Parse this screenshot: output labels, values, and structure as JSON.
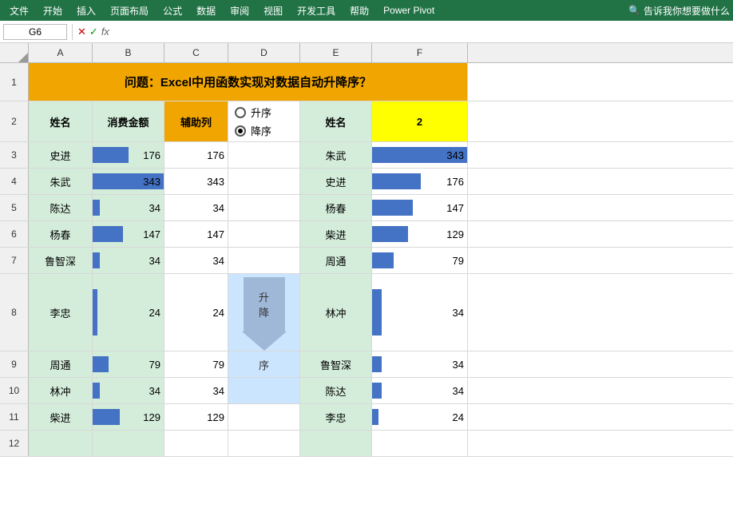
{
  "menu": {
    "items": [
      "文件",
      "开始",
      "插入",
      "页面布局",
      "公式",
      "数据",
      "审阅",
      "视图",
      "开发工具",
      "帮助",
      "Power Pivot"
    ],
    "right": "告诉我你想要做什么",
    "search_icon": "🔍"
  },
  "formula_bar": {
    "cell_ref": "G6",
    "fx": "fx"
  },
  "col_headers": [
    "A",
    "B",
    "C",
    "D",
    "E",
    "F"
  ],
  "title_row": {
    "text": "问题：Excel中用函数实现对数据自动升降序？"
  },
  "header_row": {
    "a": "姓名",
    "b": "消费金额",
    "c": "辅助列",
    "d_ascending": "升序",
    "d_descending": "降序",
    "e": "姓名",
    "f": "2"
  },
  "data": [
    {
      "row": 3,
      "a": "史进",
      "b": 176,
      "c": 176,
      "e": "朱武",
      "f": 343,
      "b_pct": 51,
      "f_pct": 100
    },
    {
      "row": 4,
      "a": "朱武",
      "b": 343,
      "c": 343,
      "e": "史进",
      "f": 176,
      "b_pct": 100,
      "f_pct": 51
    },
    {
      "row": 5,
      "a": "陈达",
      "b": 34,
      "c": 34,
      "e": "杨春",
      "f": 147,
      "b_pct": 10,
      "f_pct": 43
    },
    {
      "row": 6,
      "a": "杨春",
      "b": 147,
      "c": 147,
      "e": "柴进",
      "f": 129,
      "b_pct": 43,
      "f_pct": 38
    },
    {
      "row": 7,
      "a": "鲁智深",
      "b": 34,
      "c": 34,
      "e": "周通",
      "f": 79,
      "b_pct": 10,
      "f_pct": 23
    },
    {
      "row": 8,
      "a": "李忠",
      "b": 24,
      "c": 24,
      "e": "林冲",
      "f": 34,
      "b_pct": 7,
      "f_pct": 10
    },
    {
      "row": 9,
      "a": "周通",
      "b": 79,
      "c": 79,
      "e": "鲁智深",
      "f": 34,
      "b_pct": 23,
      "f_pct": 10
    },
    {
      "row": 10,
      "a": "林冲",
      "b": 34,
      "c": 34,
      "e": "陈达",
      "f": 34,
      "b_pct": 10,
      "f_pct": 10
    },
    {
      "row": 11,
      "a": "柴进",
      "b": 129,
      "c": 129,
      "e": "李忠",
      "f": 24,
      "b_pct": 38,
      "f_pct": 7
    }
  ],
  "arrow_label": [
    "升",
    "降",
    "序"
  ],
  "colors": {
    "menu_bg": "#217346",
    "header_orange": "#f0a500",
    "header_green": "#d4edda",
    "bar_blue": "#4472c4",
    "yellow": "#ffff00",
    "arrow_bg": "#cce5ff",
    "arrow_fill": "#a0b8d8"
  }
}
